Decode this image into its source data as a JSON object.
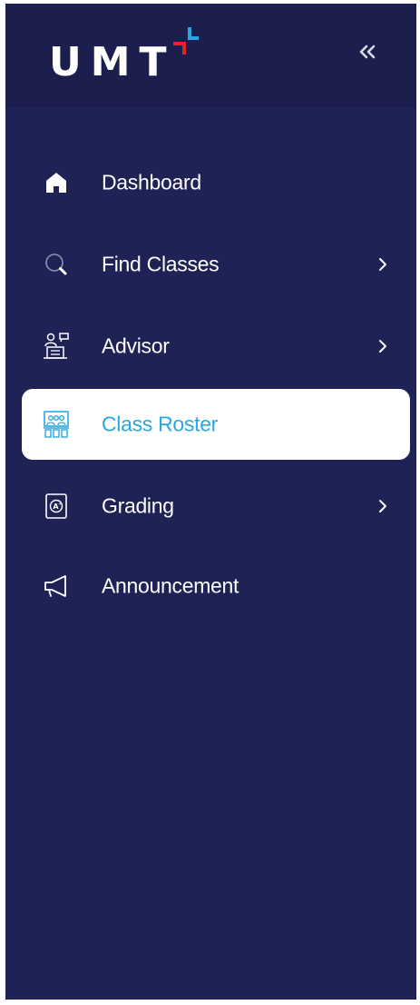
{
  "app": {
    "logo_text": "UMT"
  },
  "colors": {
    "sidebar_bg": "#1f2255",
    "header_bg": "#1c1f4e",
    "active_bg": "#ffffff",
    "active_text": "#29a8dd",
    "logo_red": "#e8212e",
    "logo_blue": "#29a8dd",
    "text": "#ffffff"
  },
  "header": {
    "collapse_icon": "double-chevron-left-icon"
  },
  "sidebar": {
    "items": [
      {
        "label": "Dashboard",
        "icon": "home-icon",
        "has_submenu": false,
        "active": false
      },
      {
        "label": "Find Classes",
        "icon": "search-icon",
        "has_submenu": true,
        "active": false
      },
      {
        "label": "Advisor",
        "icon": "advisor-icon",
        "has_submenu": true,
        "active": false
      },
      {
        "label": "Class Roster",
        "icon": "class-roster-icon",
        "has_submenu": false,
        "active": true
      },
      {
        "label": "Grading",
        "icon": "grading-icon",
        "has_submenu": true,
        "active": false
      },
      {
        "label": "Announcement",
        "icon": "megaphone-icon",
        "has_submenu": false,
        "active": false
      }
    ]
  }
}
